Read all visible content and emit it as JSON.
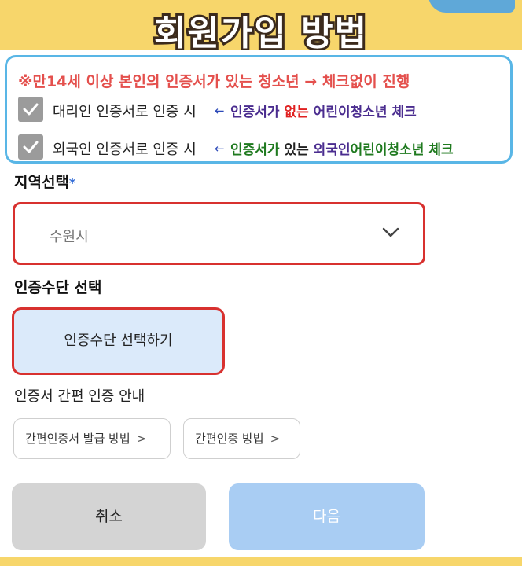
{
  "banner": {
    "title": "회원가입 방법"
  },
  "notice": {
    "headline": "※만14세 이상 본인의 인증서가 있는 청소년 → 체크없이 진행",
    "rows": [
      {
        "label": "대리인 인증서로 인증 시",
        "arrow": "←",
        "parts": [
          "인증서가 ",
          "없는",
          " 어린이청소년 체크"
        ]
      },
      {
        "label": "외국인 인증서로 인증 시",
        "arrow": "←",
        "parts": [
          "인증서가 ",
          "있는",
          " 외국인",
          "어린이청소년 체크"
        ]
      }
    ]
  },
  "region": {
    "label": "지역선택",
    "required_mark": "*",
    "selected": "수원시"
  },
  "auth_method": {
    "label": "인증수단 선택",
    "button_label": "인증수단 선택하기"
  },
  "guide": {
    "label": "인증서 간편 인증 안내",
    "links": [
      "간편인증서 발급 방법",
      "간편인증 방법"
    ]
  },
  "actions": {
    "cancel": "취소",
    "next": "다음"
  },
  "colors": {
    "banner": "#f7d66b",
    "highlight_border": "#d8312f",
    "note_border": "#59b6e6",
    "primary_disabled": "#a9cdf3",
    "checkbox": "#9b9b9b"
  }
}
